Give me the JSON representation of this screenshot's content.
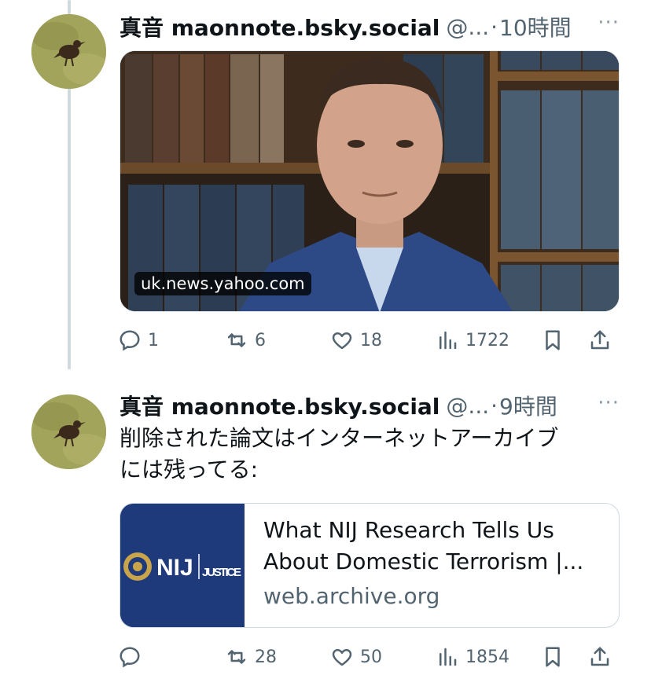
{
  "posts": [
    {
      "display_name": "真音 maonnote.bsky.social",
      "handle": "@...",
      "separator": "·",
      "time": "10時間",
      "more": "···",
      "media_domain": "uk.news.yahoo.com",
      "actions": {
        "reply": "1",
        "repost": "6",
        "like": "18",
        "views": "1722"
      }
    },
    {
      "display_name": "真音 maonnote.bsky.social",
      "handle": "@...",
      "separator": "·",
      "time": "9時間",
      "more": "···",
      "text": "削除された論文はインターネットアーカイブ\nには残ってる:",
      "link_card": {
        "title": "What NIJ Research Tells Us About Domestic Terrorism |...",
        "domain": "web.archive.org",
        "thumb_logo": "NIJ",
        "thumb_sub": "JUSTICE"
      },
      "actions": {
        "reply": "",
        "repost": "28",
        "like": "50",
        "views": "1854"
      }
    }
  ],
  "colors": {
    "text": "#0f1419",
    "secondary": "#536471",
    "nij_blue": "#1e3a7b"
  },
  "icons": [
    "reply-icon",
    "repost-icon",
    "like-icon",
    "views-icon",
    "bookmark-icon",
    "share-icon",
    "more-icon"
  ]
}
